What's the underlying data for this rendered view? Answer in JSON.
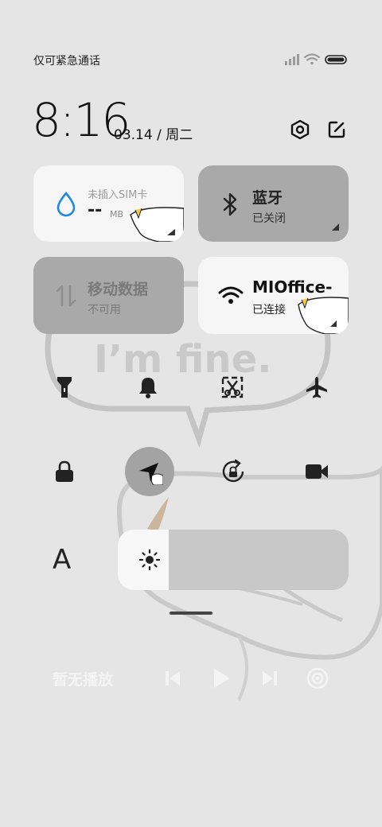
{
  "status_bar": {
    "carrier_text": "仅可紧急通话",
    "icons": [
      "cellular-signal-icon",
      "wifi-icon",
      "battery-icon"
    ]
  },
  "header": {
    "time": "8:16",
    "date": "03.14 / 周二",
    "settings_icon": "settings-hex-icon",
    "edit_icon": "edit-icon"
  },
  "tiles": {
    "data_usage": {
      "title": "未插入SIM卡",
      "value": "--",
      "unit": "MB",
      "icon": "water-drop-icon"
    },
    "bluetooth": {
      "title": "蓝牙",
      "status": "已关闭",
      "icon": "bluetooth-icon"
    },
    "mobile_data": {
      "title": "移动数据",
      "status": "不可用",
      "icon": "data-arrows-icon"
    },
    "wifi": {
      "title": "MIOffice-",
      "status": "已连接",
      "icon": "wifi-icon"
    }
  },
  "toggles_row1": [
    "flashlight-icon",
    "bell-icon",
    "screenshot-icon",
    "airplane-icon"
  ],
  "toggles_row2": [
    "lock-icon",
    "location-icon",
    "rotation-lock-icon",
    "video-camera-icon"
  ],
  "font_label": "A",
  "brightness": {
    "level": 0.22,
    "icon": "sun-icon"
  },
  "media": {
    "title": "暂无播放",
    "controls": [
      "previous-icon",
      "play-icon",
      "next-icon",
      "cast-icon"
    ]
  },
  "wallpaper_text": "I’m fine.",
  "colors": {
    "background": "#e6e5e5",
    "tile_white": "#f6f6f6",
    "tile_gray": "#a9a9a9",
    "accent_blue": "#1e88e5"
  }
}
